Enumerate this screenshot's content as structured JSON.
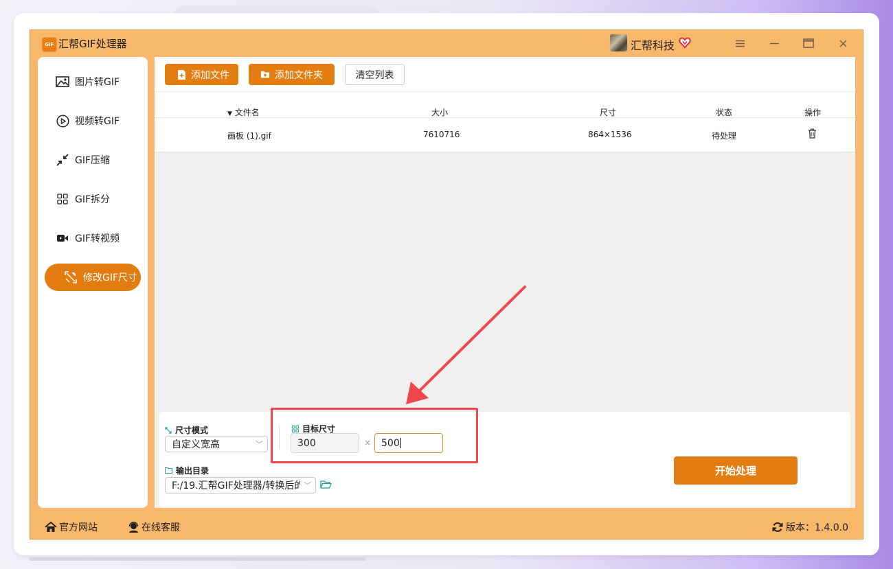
{
  "app": {
    "logo_text": "GIF",
    "title": "汇帮GIF处理器",
    "user_name": "汇帮科技"
  },
  "window_controls": {
    "menu_icon": "hamburger-icon",
    "minimize_icon": "minimize-icon",
    "maximize_icon": "maximize-icon",
    "close_icon": "close-icon"
  },
  "sidebar": {
    "items": [
      {
        "label": "图片转GIF",
        "icon": "image-icon"
      },
      {
        "label": "视频转GIF",
        "icon": "play-circle-icon"
      },
      {
        "label": "GIF压缩",
        "icon": "compress-icon"
      },
      {
        "label": "GIF拆分",
        "icon": "split-icon"
      },
      {
        "label": "GIF转视频",
        "icon": "video-camera-icon"
      },
      {
        "label": "修改GIF尺寸",
        "icon": "resize-icon",
        "active": true
      }
    ]
  },
  "toolbar": {
    "add_file": "添加文件",
    "add_folder": "添加文件夹",
    "clear_list": "清空列表"
  },
  "table": {
    "columns": [
      "文件名",
      "大小",
      "尺寸",
      "状态",
      "操作"
    ],
    "rows": [
      {
        "name": "画板 (1).gif",
        "size": "7610716",
        "dimensions": "864×1536",
        "status": "待处理",
        "action_icon": "trash-icon"
      }
    ]
  },
  "settings": {
    "size_mode_label": "尺寸模式",
    "size_mode_value": "自定义宽高",
    "target_size_label": "目标尺寸",
    "width_value": "300",
    "times_symbol": "×",
    "height_value": "500",
    "output_dir_label": "输出目录",
    "output_dir_value": "F:/19.汇帮GIF处理器/转换后的",
    "start_button": "开始处理"
  },
  "footer": {
    "website": "官方网站",
    "support": "在线客服",
    "version": "版本：1.4.0.0"
  },
  "colors": {
    "accent": "#e47d11",
    "window_bg": "#f8b86c",
    "annotation": "#f0474f"
  }
}
